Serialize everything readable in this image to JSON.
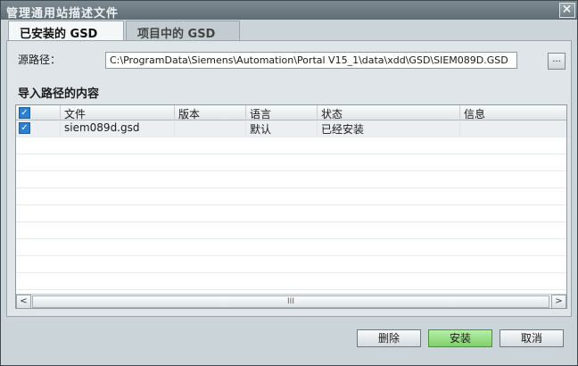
{
  "window": {
    "title": "管理通用站描述文件",
    "close_glyph": "✕"
  },
  "tabs": [
    {
      "label": "已安装的 GSD",
      "active": true
    },
    {
      "label": "项目中的 GSD",
      "active": false
    }
  ],
  "source": {
    "label": "源路径：",
    "path": "C:\\ProgramData\\Siemens\\Automation\\Portal V15_1\\data\\xdd\\GSD\\SIEM089D.GSD",
    "browse_label": "..."
  },
  "content": {
    "title": "导入路径的内容",
    "columns": [
      "文件",
      "版本",
      "语言",
      "状态",
      "信息"
    ],
    "header_checked": true,
    "rows": [
      {
        "checked": true,
        "file": "siem089d.gsd",
        "version": "",
        "language": "默认",
        "status": "已经安装",
        "info": ""
      }
    ]
  },
  "scrollbar": {
    "left": "<",
    "right": ">",
    "grip": "III"
  },
  "buttons": {
    "delete": "删除",
    "install": "安装",
    "cancel": "取消"
  },
  "colors": {
    "accent_checkbox": "#2d7fd1",
    "primary_button": "#7fd06c"
  }
}
